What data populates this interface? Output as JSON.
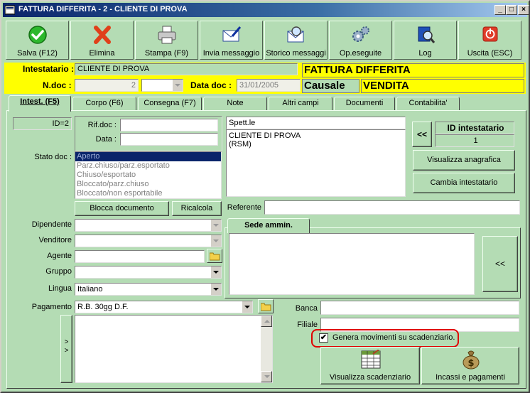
{
  "window": {
    "title": "FATTURA DIFFERITA - 2  - CLIENTE DI PROVA",
    "minimize": "_",
    "maximize": "□",
    "close": "×"
  },
  "toolbar": [
    {
      "label": "Salva (F12)",
      "icon": "check-icon"
    },
    {
      "label": "Elimina",
      "icon": "delete-x-icon"
    },
    {
      "label": "Stampa (F9)",
      "icon": "printer-icon"
    },
    {
      "label": "Invia messaggio",
      "icon": "envelope-pen-icon"
    },
    {
      "label": "Storico messaggi",
      "icon": "envelope-search-icon"
    },
    {
      "label": "Op.eseguite",
      "icon": "gears-icon"
    },
    {
      "label": "Log",
      "icon": "book-magnifier-icon"
    },
    {
      "label": "Uscita (ESC)",
      "icon": "power-icon"
    }
  ],
  "header": {
    "intestatario_label": "Intestatario :",
    "intestatario_value": "CLIENTE DI PROVA",
    "doc_type": "FATTURA DIFFERITA",
    "ndoc_label": "N.doc :",
    "ndoc_value": "2",
    "ndoc_suffix": "",
    "data_doc_label": "Data doc :",
    "data_doc_value": "31/01/2005",
    "causale_label": "Causale",
    "causale_value": "VENDITA"
  },
  "tabs": [
    {
      "label": "Intest. (F5)",
      "active": true
    },
    {
      "label": "Corpo (F6)"
    },
    {
      "label": "Consegna (F7)"
    },
    {
      "label": "Note"
    },
    {
      "label": "Altri campi"
    },
    {
      "label": "Documenti"
    },
    {
      "label": "Contabilita'"
    }
  ],
  "intest": {
    "id_label": "ID=2",
    "rif_doc_label": "Rif.doc :",
    "rif_doc_value": "",
    "data_label": "Data :",
    "data_value": "",
    "stato_doc_label": "Stato doc :",
    "stato_options": [
      "Aperto",
      "Parz.chiuso/parz.esportato",
      "Chiuso/esportato",
      "Bloccato/parz.chiuso",
      "Bloccato/non esportabile"
    ],
    "blocca_button": "Blocca documento",
    "ricalcola_button": "Ricalcola",
    "spett_value": "Spett.le",
    "address_line1": "CLIENTE DI PROVA",
    "address_line2": "(RSM)",
    "back_button": "<<",
    "id_intestatario_label": "ID intestatario",
    "id_intestatario_value": "1",
    "visualizza_anagrafica": "Visualizza anagrafica",
    "cambia_intestatario": "Cambia intestatario",
    "referente_label": "Referente",
    "referente_value": "",
    "dipendente_label": "Dipendente",
    "venditore_label": "Venditore",
    "agente_label": "Agente",
    "gruppo_label": "Gruppo",
    "lingua_label": "Lingua",
    "lingua_value": "Italiano",
    "sede_tab": "Sede ammin.",
    "sede_back_button": "<<",
    "pagamento_label": "Pagamento",
    "pagamento_value": "R.B. 30gg D.F.",
    "expand_arrows": "> >",
    "banca_label": "Banca",
    "banca_value": "",
    "filiale_label": "Filiale",
    "filiale_value": "",
    "genera_label": "Genera movimenti su scadenziario.",
    "genera_checked": "✔",
    "visualizza_scadenziario": "Visualizza scadenziario",
    "incassi_pagamenti": "Incassi e pagamenti"
  }
}
